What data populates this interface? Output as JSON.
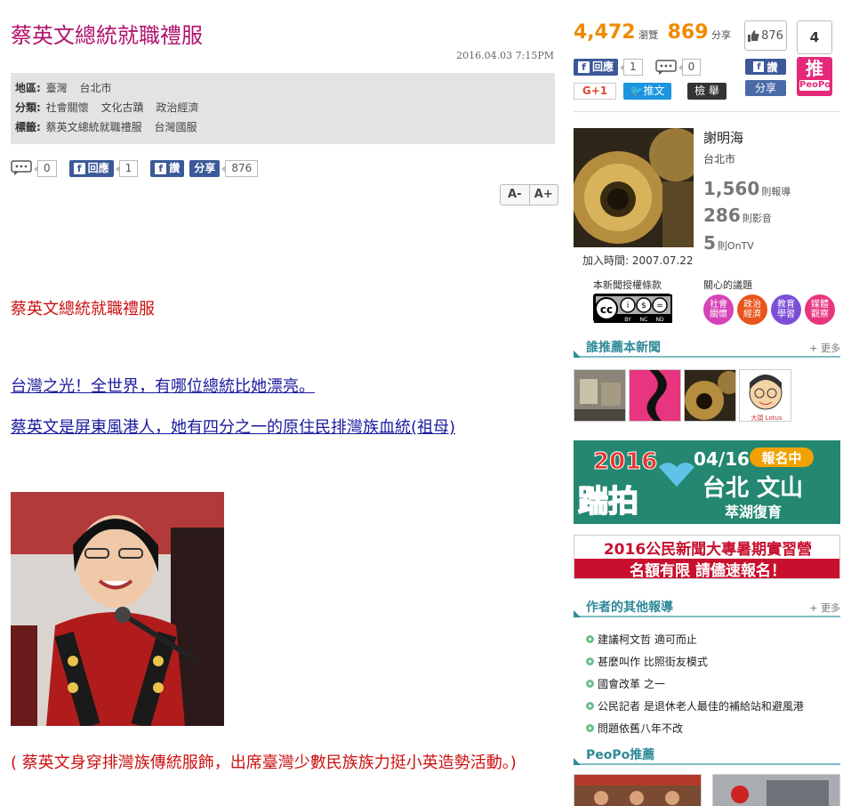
{
  "article": {
    "title": "蔡英文總統就職禮服",
    "date": "2016.04.03 7:15PM",
    "meta": [
      {
        "key": "地區:",
        "values": [
          "臺灣",
          "台北市"
        ]
      },
      {
        "key": "分類:",
        "values": [
          "社會關懷",
          "文化古蹟",
          "政治經濟"
        ]
      },
      {
        "key": "標籤:",
        "values": [
          "蔡英文總統就職禮服",
          "台灣國服"
        ]
      }
    ],
    "share": {
      "comments": "0",
      "reply_label": "回應",
      "reply_count": "1",
      "fb_say_label": "讚",
      "share_label": "分享",
      "share_count": "876"
    },
    "font_smaller": "A-",
    "font_larger": "A+",
    "subtitle": "蔡英文總統就職禮服",
    "link1": "台灣之光！全世界，有哪位總統比她漂亮。",
    "link2": "蔡英文是屏東風港人，她有四分之一的原住民排灣族血統(祖母)",
    "caption": "( 蔡英文身穿排灣族傳統服飾，出席臺灣少數民族族力挺小英造勢活動。)"
  },
  "sidebar": {
    "views": "4,472",
    "views_label": "瀏覽",
    "shares": "869",
    "shares_label": "分享",
    "like_count": "876",
    "push_count": "4",
    "push_label": "推",
    "push_brand": "PeoPo",
    "reply_label": "回應",
    "reply_count": "1",
    "comment_count": "0",
    "fb_say_label": "讚",
    "share_label": "分享",
    "gplus_label": "G+1",
    "tweet_label": "推文",
    "report_label": "檢 舉",
    "author": {
      "name": "謝明海",
      "location": "台北市",
      "reports": "1,560",
      "reports_label": "則報導",
      "audio": "286",
      "audio_label": "則影音",
      "ontv": "5",
      "ontv_label": "則OnTV",
      "joined": "加入時間: 2007.07.22"
    },
    "license_label": "本新聞授權條款",
    "cc_labels": [
      "BY",
      "NC",
      "ND"
    ],
    "topics_label": "關心的議題",
    "topics": [
      {
        "label": "社會關懷",
        "color": "#d642b8"
      },
      {
        "label": "政治經濟",
        "color": "#e8541c"
      },
      {
        "label": "教育學習",
        "color": "#7b4fd6"
      },
      {
        "label": "媒體觀察",
        "color": "#e8357f"
      }
    ],
    "recommend_head": "誰推薦本新聞",
    "more": "+ 更多",
    "banner1": {
      "year": "2016",
      "date": "04/16",
      "tag": "報名中",
      "place": "台北 文山",
      "sub": "萃湖復育",
      "logo": "踹拍"
    },
    "banner2": {
      "line1": "2016公民新聞大專暑期實習營",
      "line2": "名額有限 請儘速報名！"
    },
    "other_head": "作者的其他報導",
    "other_list": [
      "建議柯文哲 適可而止",
      "甚麼叫作 比照街友模式",
      "國會改革 之一",
      "公民記者 是退休老人最佳的補給站和避風港",
      "問題依舊八年不改"
    ],
    "peopo_head": "PeoPo推薦"
  }
}
